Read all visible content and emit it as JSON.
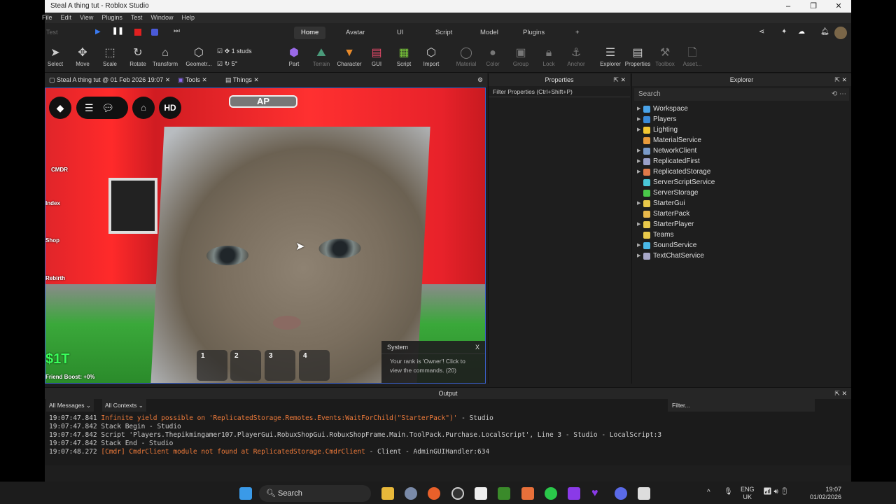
{
  "window": {
    "title": "Steal A thing tut - Roblox Studio"
  },
  "menu": [
    "File",
    "Edit",
    "View",
    "Plugins",
    "Test",
    "Window",
    "Help"
  ],
  "test_mode": "Test",
  "ribbon_tabs": [
    "Home",
    "Avatar",
    "UI",
    "Script",
    "Model",
    "Plugins",
    "+"
  ],
  "tools": [
    "Select",
    "Move",
    "Scale",
    "Rotate",
    "Transform",
    "Geometr...",
    "Part",
    "Terrain",
    "Character",
    "GUI",
    "Script",
    "Import",
    "Material",
    "Color",
    "Group",
    "Lock",
    "Anchor",
    "Explorer",
    "Properties",
    "Toolbox",
    "Asset..."
  ],
  "snap": {
    "move": "1 studs",
    "rotate": "5°"
  },
  "doc_tabs": [
    "Steal A thing tut @ 01 Feb 2026 19:07",
    "Tools",
    "Things"
  ],
  "game": {
    "top_badge": "AP",
    "hd": "HD",
    "side_buttons": [
      "CMDR",
      "Index",
      "Shop",
      "Rebirth"
    ],
    "money": "$1T",
    "friend_boost": "Friend Boost: +0%",
    "hotbar": [
      "1",
      "2",
      "3",
      "4"
    ],
    "system_title": "System",
    "system_close": "X",
    "system_msg": "Your rank is 'Owner'! Click to view the commands. (20)"
  },
  "properties": {
    "title": "Properties",
    "filter": "Filter Properties (Ctrl+Shift+P)"
  },
  "explorer": {
    "title": "Explorer",
    "search_placeholder": "Search",
    "items": [
      {
        "name": "Workspace",
        "arrow": true,
        "color": "#4aa3e8"
      },
      {
        "name": "Players",
        "arrow": true,
        "color": "#3a8ad8"
      },
      {
        "name": "Lighting",
        "arrow": true,
        "color": "#f2c632"
      },
      {
        "name": "MaterialService",
        "arrow": false,
        "color": "#e89a3a"
      },
      {
        "name": "NetworkClient",
        "arrow": true,
        "color": "#7a9ac8"
      },
      {
        "name": "ReplicatedFirst",
        "arrow": true,
        "color": "#9aa0c8"
      },
      {
        "name": "ReplicatedStorage",
        "arrow": true,
        "color": "#e07a4a"
      },
      {
        "name": "ServerScriptService",
        "arrow": false,
        "color": "#4ac8d8"
      },
      {
        "name": "ServerStorage",
        "arrow": false,
        "color": "#4ac84a"
      },
      {
        "name": "StarterGui",
        "arrow": true,
        "color": "#e8c84a"
      },
      {
        "name": "StarterPack",
        "arrow": false,
        "color": "#e8b84a"
      },
      {
        "name": "StarterPlayer",
        "arrow": true,
        "color": "#e8c84a"
      },
      {
        "name": "Teams",
        "arrow": false,
        "color": "#e8c84a"
      },
      {
        "name": "SoundService",
        "arrow": true,
        "color": "#4ab8e8"
      },
      {
        "name": "TextChatService",
        "arrow": true,
        "color": "#a8a8c8"
      }
    ]
  },
  "output": {
    "title": "Output",
    "filter1": "All Messages",
    "filter2": "All Contexts",
    "filter_placeholder": "Filter...",
    "lines": [
      {
        "time": "19:07:47.841",
        "text": "Infinite yield possible on 'ReplicatedStorage.Remotes.Events:WaitForChild(\"StarterPack\")'",
        "suffix": "  -  Studio",
        "kind": "err"
      },
      {
        "time": "19:07:47.842",
        "text": "Stack Begin",
        "suffix": "  -  Studio",
        "kind": "nrm"
      },
      {
        "time": "19:07:47.842",
        "text": "Script 'Players.Thepikmingamer107.PlayerGui.RobuxShopGui.RobuxShopFrame.Main.ToolPack.Purchase.LocalScript', Line 3",
        "suffix": "  -  Studio - LocalScript:3",
        "kind": "nrm"
      },
      {
        "time": "19:07:47.842",
        "text": "Stack End",
        "suffix": "  -  Studio",
        "kind": "nrm"
      },
      {
        "time": "19:07:48.272",
        "text": "[Cmdr] CmdrClient module not found at ReplicatedStorage.CmdrClient",
        "suffix": "  -  Client - AdminGUIHandler:634",
        "kind": "err"
      }
    ]
  },
  "taskbar": {
    "search": "Search",
    "lang1": "ENG",
    "lang2": "UK",
    "time": "19:07",
    "date": "01/02/2026"
  }
}
